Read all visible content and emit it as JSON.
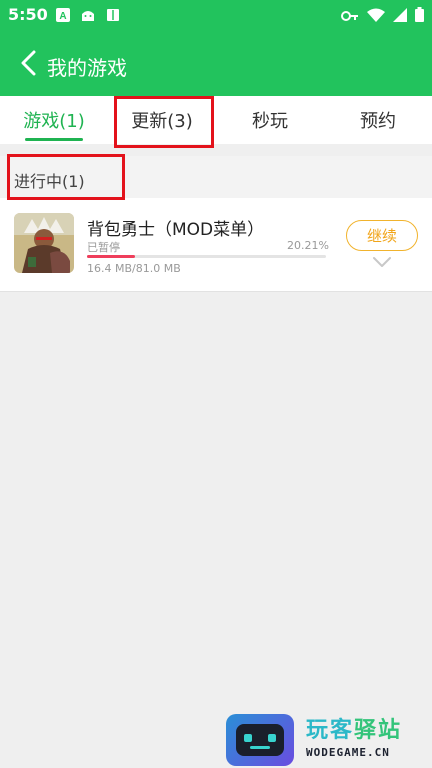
{
  "status_bar": {
    "time": "5:50",
    "left_icons": [
      "a-icon",
      "android-icon",
      "book-icon"
    ],
    "right_icons": [
      "key-icon",
      "wifi-icon",
      "signal-icon",
      "battery-icon"
    ]
  },
  "app_bar": {
    "back_icon": "chevron-left-icon",
    "title": "我的游戏",
    "background_color": "#22c35d"
  },
  "tabs": [
    {
      "label": "游戏(1)",
      "active": true
    },
    {
      "label": "更新(3)",
      "active": false
    },
    {
      "label": "秒玩",
      "active": false
    },
    {
      "label": "预约",
      "active": false
    }
  ],
  "section": {
    "title": "进行中(1)"
  },
  "download_item": {
    "name": "背包勇士（MOD菜单）",
    "status": "已暂停",
    "percent_text": "20.21%",
    "progress": 0.2021,
    "size_text": "16.4 MB/81.0 MB",
    "action_label": "继续",
    "expand_icon": "chevron-down-icon",
    "progress_color": "#ef3e5b",
    "action_color": "#f1a51a"
  },
  "watermark": {
    "title_part1": "玩客",
    "title_part2": "驿站",
    "url": "WODEGAME.CN"
  },
  "annotations": {
    "highlight_color": "#e3121b"
  }
}
